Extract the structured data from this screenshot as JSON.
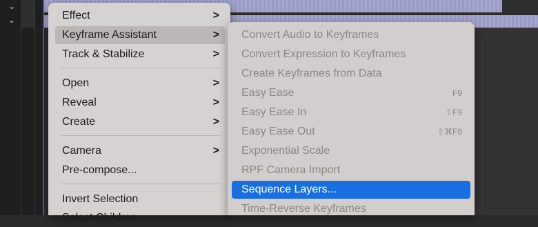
{
  "background": {
    "chevrons": [
      "⌄",
      "⌄"
    ]
  },
  "menu": {
    "items": [
      {
        "label": "Effect",
        "arrow": ">"
      },
      {
        "label": "Keyframe Assistant",
        "arrow": ">"
      },
      {
        "label": "Track & Stabilize",
        "arrow": ">"
      },
      {
        "label": "Open",
        "arrow": ">"
      },
      {
        "label": "Reveal",
        "arrow": ">"
      },
      {
        "label": "Create",
        "arrow": ">"
      },
      {
        "label": "Camera",
        "arrow": ">"
      },
      {
        "label": "Pre-compose..."
      },
      {
        "label": "Invert Selection"
      },
      {
        "label": "Select Children"
      }
    ]
  },
  "submenu": {
    "items": [
      {
        "label": "Convert Audio to Keyframes"
      },
      {
        "label": "Convert Expression to Keyframes"
      },
      {
        "label": "Create Keyframes from Data"
      },
      {
        "label": "Easy Ease",
        "shortcut": "F9"
      },
      {
        "label": "Easy Ease In",
        "shortcut": "⇧F9"
      },
      {
        "label": "Easy Ease Out",
        "shortcut": "⇧⌘F9"
      },
      {
        "label": "Exponential Scale"
      },
      {
        "label": "RPF Camera Import"
      },
      {
        "label": "Sequence Layers..."
      },
      {
        "label": "Time-Reverse Keyframes"
      }
    ]
  },
  "colors": {
    "selection": "#1a6fe0",
    "menu_bg": "#d6d2d1",
    "disabled_text": "#8a8787",
    "timeline_strip": "#9a9bc4"
  }
}
